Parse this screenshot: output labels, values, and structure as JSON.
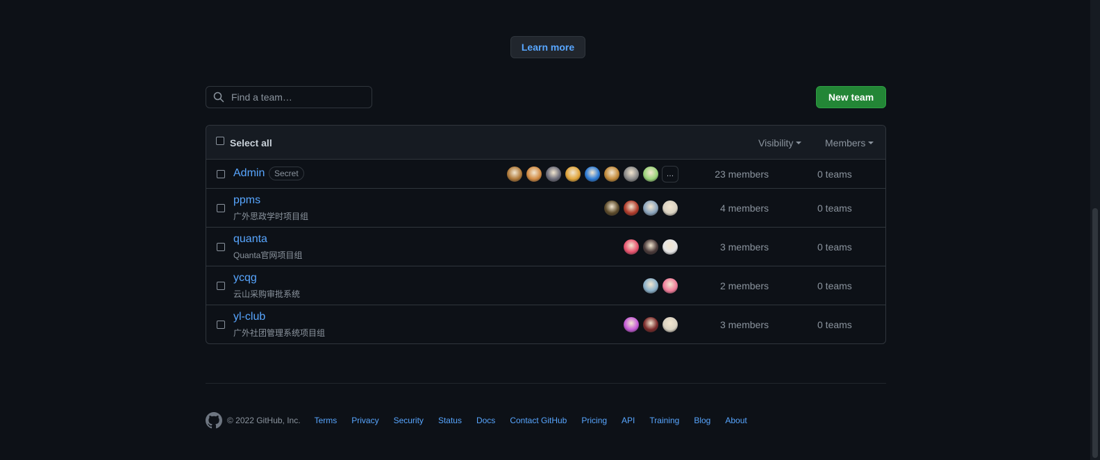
{
  "learn_more": "Learn more",
  "search": {
    "placeholder": "Find a team…"
  },
  "new_team": "New team",
  "table_header": {
    "select_all": "Select all",
    "visibility": "Visibility",
    "members": "Members"
  },
  "teams": [
    {
      "name": "Admin",
      "description": "",
      "badge": "Secret",
      "members": "23 members",
      "teams": "0 teams",
      "more": "…",
      "avatar_colors": [
        "#b07a3a",
        "#d28b43",
        "#6c6c7a",
        "#e0a43a",
        "#2c7bd6",
        "#c28a3a",
        "#8a8a8a",
        "#9ad27a"
      ]
    },
    {
      "name": "ppms",
      "description": "广外思政学时项目组",
      "badge": "",
      "members": "4 members",
      "teams": "0 teams",
      "more": "",
      "avatar_colors": [
        "#5b4a2a",
        "#b03a2a",
        "#8aa4bd",
        "#d9d2c2"
      ]
    },
    {
      "name": "quanta",
      "description": "Quanta官网项目组",
      "badge": "",
      "members": "3 members",
      "teams": "0 teams",
      "more": "",
      "avatar_colors": [
        "#e8526e",
        "#4a3a3a",
        "#e6e6e6"
      ]
    },
    {
      "name": "ycqg",
      "description": "云山采购审批系统",
      "badge": "",
      "members": "2 members",
      "teams": "0 teams",
      "more": "",
      "avatar_colors": [
        "#8ab0c9",
        "#f17c9a"
      ]
    },
    {
      "name": "yl-club",
      "description": "广外社团管理系统项目组",
      "badge": "",
      "members": "3 members",
      "teams": "0 teams",
      "more": "",
      "avatar_colors": [
        "#c45ad6",
        "#7a2a2a",
        "#d9d2c2"
      ]
    }
  ],
  "footer": {
    "copyright": "© 2022 GitHub, Inc.",
    "links": [
      "Terms",
      "Privacy",
      "Security",
      "Status",
      "Docs",
      "Contact GitHub",
      "Pricing",
      "API",
      "Training",
      "Blog",
      "About"
    ]
  }
}
